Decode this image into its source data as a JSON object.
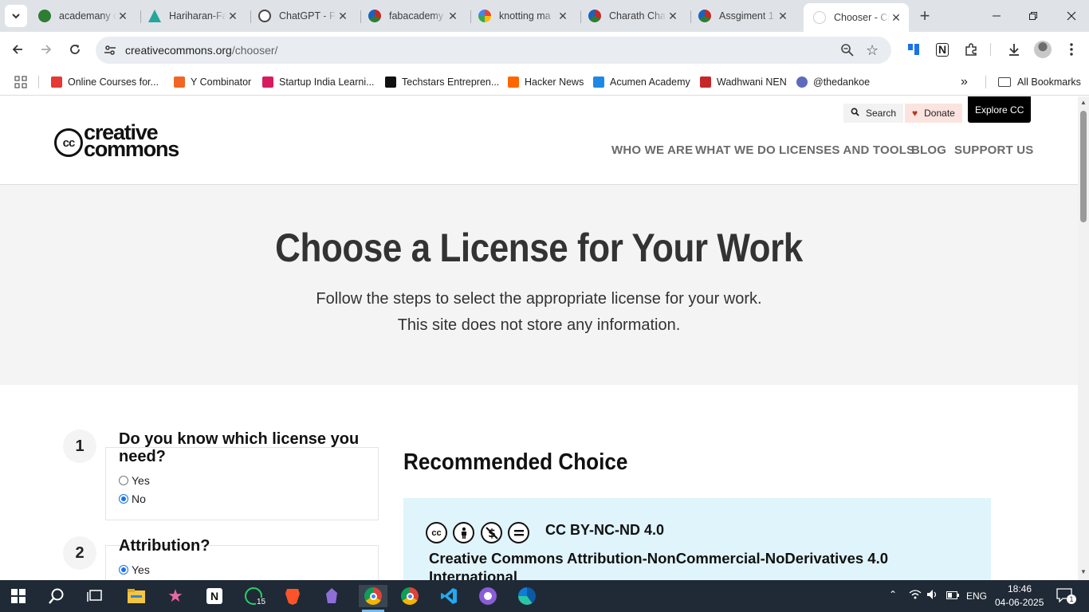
{
  "browser": {
    "tabs": [
      {
        "title": "academany c",
        "icon": "academany-favicon",
        "color": "#2e7d32"
      },
      {
        "title": "Hariharan-Fa",
        "icon": "hariharan-favicon",
        "color": "#26a69a"
      },
      {
        "title": "ChatGPT - Fa",
        "icon": "chatgpt-favicon",
        "color": "#444444"
      },
      {
        "title": "fabacademy",
        "icon": "fabacademy-favicon",
        "color": "#c62828"
      },
      {
        "title": "knotting ma",
        "icon": "google-favicon",
        "color": "#4285f4"
      },
      {
        "title": "Charath Cha",
        "icon": "fabacademy-favicon",
        "color": "#c62828"
      },
      {
        "title": "Assgiment 1",
        "icon": "fabacademy-favicon",
        "color": "#c62828"
      },
      {
        "title": "Chooser - Cr",
        "icon": "cc-favicon",
        "color": "#bbbbbb",
        "active": true
      }
    ],
    "new_tab": "+",
    "url_host": "creativecommons.org",
    "url_path": "/chooser/",
    "bookmarks": [
      {
        "label": "Online Courses for...",
        "color": "#e53935"
      },
      {
        "label": "Y Combinator",
        "color": "#f26522"
      },
      {
        "label": "Startup India Learni...",
        "color": "#d81b60"
      },
      {
        "label": "Techstars Entrepren...",
        "color": "#111111"
      },
      {
        "label": "Hacker News",
        "color": "#ff6600"
      },
      {
        "label": "Acumen Academy",
        "color": "#1e88e5"
      },
      {
        "label": "Wadhwani NEN",
        "color": "#c62828"
      },
      {
        "label": "@thedankoe",
        "color": "#5c6bc0"
      }
    ],
    "bookmarks_overflow": "»",
    "all_bookmarks": "All Bookmarks"
  },
  "site": {
    "logo_line1": "creative",
    "logo_line2": "commons",
    "logo_mark": "cc",
    "search_label": "Search",
    "donate_label": "Donate",
    "explore_label": "Explore CC",
    "nav": [
      "WHO WE ARE",
      "WHAT WE DO",
      "LICENSES AND TOOLS",
      "BLOG",
      "SUPPORT US"
    ],
    "hero_title": "Choose a License for Your Work",
    "hero_sub1": "Follow the steps to select the appropriate license for your work.",
    "hero_sub2": "This site does not store any information.",
    "steps": [
      {
        "number": "1",
        "question_line1": "Do you know which license you",
        "question_line2": "need?",
        "options": [
          {
            "label": "Yes",
            "selected": false
          },
          {
            "label": "No",
            "selected": true
          }
        ]
      },
      {
        "number": "2",
        "question_line1": "Attribution?",
        "options": [
          {
            "label": "Yes",
            "selected": true
          }
        ]
      }
    ],
    "recommended_title": "Recommended Choice",
    "license_short": "CC BY-NC-ND 4.0",
    "license_full_line1": "Creative Commons Attribution-NonCommercial-NoDerivatives 4.0",
    "license_full_line2": "International",
    "license_icons": [
      "cc-icon",
      "by-icon",
      "nc-icon",
      "nd-icon"
    ]
  },
  "taskbar": {
    "whatsapp_badge": "15",
    "lang": "ENG",
    "time": "18:46",
    "date": "04-06-2025",
    "notif_count": "1"
  }
}
